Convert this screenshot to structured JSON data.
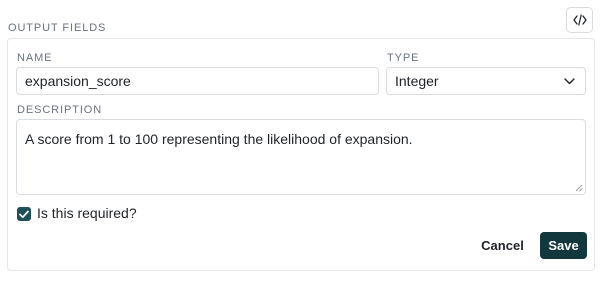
{
  "section": {
    "label": "OUTPUT FIELDS"
  },
  "toolbar": {
    "code_icon": "code-brackets-icon"
  },
  "field": {
    "name_label": "NAME",
    "name_value": "expansion_score",
    "type_label": "TYPE",
    "type_value": "Integer",
    "description_label": "DESCRIPTION",
    "description_value": "A score from 1 to 100 representing the likelihood of expansion.",
    "required_label": "Is this required?",
    "required_checked": true
  },
  "actions": {
    "cancel_label": "Cancel",
    "save_label": "Save"
  },
  "colors": {
    "primary": "#12383d",
    "checkbox": "#1f4f57",
    "border": "#d9dce1",
    "muted_text": "#6b7280"
  }
}
